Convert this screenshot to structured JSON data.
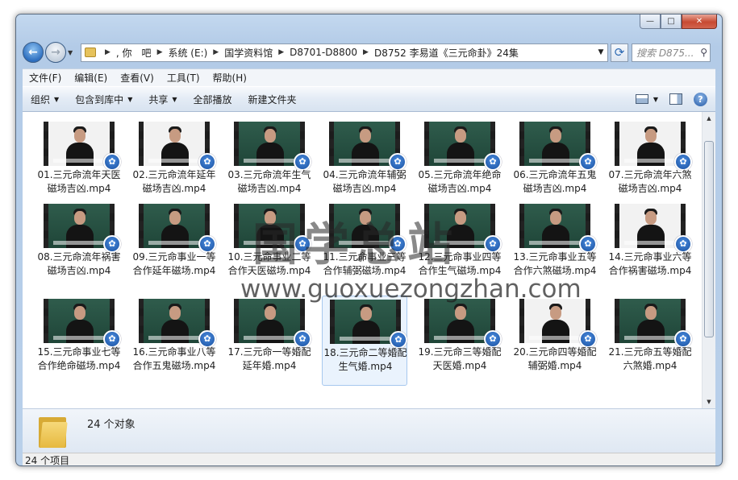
{
  "window": {
    "caption": {
      "minimize": "—",
      "maximize": "□",
      "close": "✕"
    }
  },
  "nav": {
    "back_icon": "back-arrow-icon",
    "forward_icon": "forward-arrow-icon",
    "breadcrumb": [
      ", 你　吧",
      "系统 (E:)",
      "国学资料馆",
      "D8701-D8800",
      "D8752 李易道《三元命卦》24集"
    ],
    "search_placeholder": "搜索 D875..."
  },
  "menu": [
    "文件(F)",
    "编辑(E)",
    "查看(V)",
    "工具(T)",
    "帮助(H)"
  ],
  "toolbar": {
    "organize": "组织",
    "include_library": "包含到库中",
    "share": "共享",
    "play_all": "全部播放",
    "new_folder": "新建文件夹"
  },
  "files": [
    {
      "name": "01.三元命流年天医磁场吉凶.mp4",
      "style": "white"
    },
    {
      "name": "02.三元命流年延年磁场吉凶.mp4",
      "style": "white"
    },
    {
      "name": "03.三元命流年生气磁场吉凶.mp4",
      "style": "green"
    },
    {
      "name": "04.三元命流年辅弼磁场吉凶.mp4",
      "style": "green"
    },
    {
      "name": "05.三元命流年绝命磁场吉凶.mp4",
      "style": "green"
    },
    {
      "name": "06.三元命流年五鬼磁场吉凶.mp4",
      "style": "green"
    },
    {
      "name": "07.三元命流年六煞磁场吉凶.mp4",
      "style": "white"
    },
    {
      "name": "08.三元命流年祸害磁场吉凶.mp4",
      "style": "green"
    },
    {
      "name": "09.三元命事业一等合作延年磁场.mp4",
      "style": "green"
    },
    {
      "name": "10.三元命事业二等合作天医磁场.mp4",
      "style": "green"
    },
    {
      "name": "11.三元命事业三等合作辅弼磁场.mp4",
      "style": "green"
    },
    {
      "name": "12.三元命事业四等合作生气磁场.mp4",
      "style": "green"
    },
    {
      "name": "13.三元命事业五等合作六煞磁场.mp4",
      "style": "green"
    },
    {
      "name": "14.三元命事业六等合作祸害磁场.mp4",
      "style": "white"
    },
    {
      "name": "15.三元命事业七等合作绝命磁场.mp4",
      "style": "green"
    },
    {
      "name": "16.三元命事业八等合作五鬼磁场.mp4",
      "style": "green"
    },
    {
      "name": "17.三元命一等婚配延年婚.mp4",
      "style": "green"
    },
    {
      "name": "18.三元命二等婚配生气婚.mp4",
      "style": "green"
    },
    {
      "name": "19.三元命三等婚配天医婚.mp4",
      "style": "green"
    },
    {
      "name": "20.三元命四等婚配辅弼婚.mp4",
      "style": "white"
    },
    {
      "name": "21.三元命五等婚配六煞婚.mp4",
      "style": "green"
    }
  ],
  "selected_index": 17,
  "watermark": {
    "title": "国学总站",
    "url": "www.guoxuezongzhan.com"
  },
  "details": {
    "object_count": "24 个对象"
  },
  "status": {
    "item_count": "24 个项目"
  }
}
